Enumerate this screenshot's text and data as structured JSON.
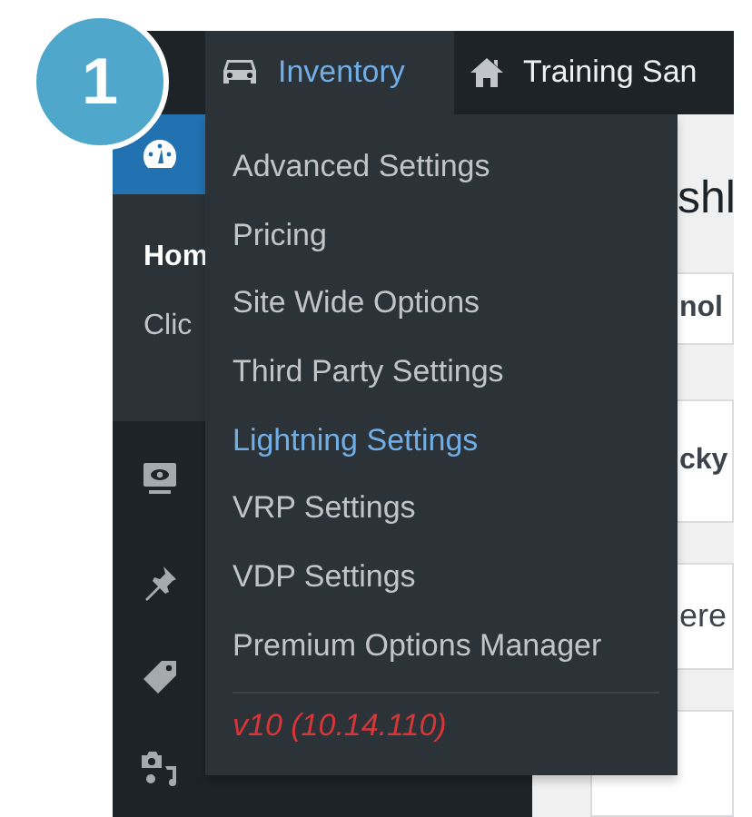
{
  "step_badge": "1",
  "admin_bar": {
    "items": [
      {
        "label": "Inventory",
        "open": true
      },
      {
        "label": "Training San",
        "open": false
      }
    ]
  },
  "sidebar": {
    "items": [
      {
        "current": true
      },
      {
        "current": false
      },
      {
        "current": false
      },
      {
        "current": false
      },
      {
        "current": false
      }
    ],
    "submenu": [
      {
        "label": "Hom",
        "selected": true
      },
      {
        "label": "Clic",
        "selected": false
      }
    ]
  },
  "content": {
    "heading": "shl",
    "fragments": [
      "nol",
      "cky",
      "ere"
    ]
  },
  "dropdown": {
    "items": [
      {
        "label": "Advanced Settings",
        "selected": false
      },
      {
        "label": "Pricing",
        "selected": false
      },
      {
        "label": "Site Wide Options",
        "selected": false
      },
      {
        "label": "Third Party Settings",
        "selected": false
      },
      {
        "label": "Lightning Settings",
        "selected": true
      },
      {
        "label": "VRP Settings",
        "selected": false
      },
      {
        "label": "VDP Settings",
        "selected": false
      },
      {
        "label": "Premium Options Manager",
        "selected": false
      }
    ],
    "version": "v10 (10.14.110)"
  }
}
